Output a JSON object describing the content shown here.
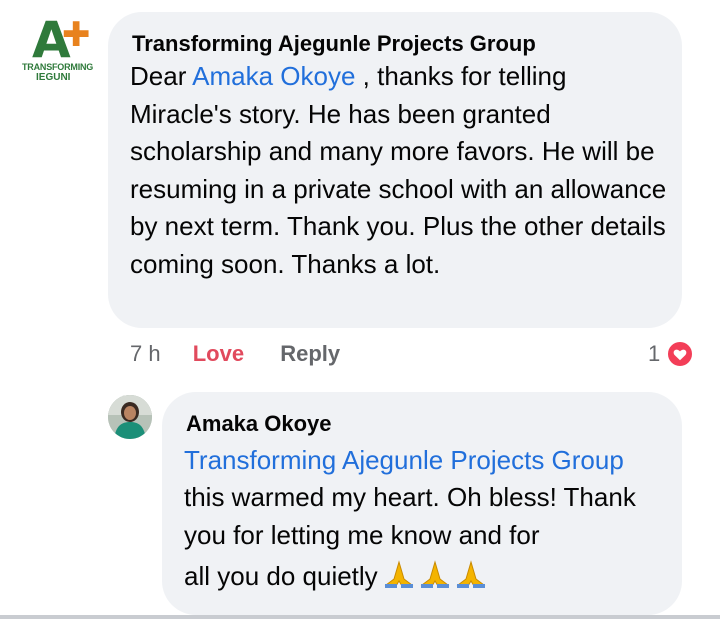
{
  "comment": {
    "logo_letter": "A",
    "logo_line1": "TRANSFORMING",
    "logo_line2": "IEGUNI",
    "author": "Transforming Ajegunle Projects Group",
    "text_before_mention": "Dear ",
    "mention": "Amaka Okoye",
    "text_after_mention": " , thanks for telling Miracle's story. He has been granted scholarship and many more favors. He will be resuming in a private school with an allowance by next term. Thank you. Plus the other details coming soon. Thanks a lot.",
    "time": "7 h",
    "love_label": "Love",
    "reply_label": "Reply",
    "reaction_count": "1",
    "reaction_icon": "heart-icon",
    "reaction_color": "#f33e58"
  },
  "reply": {
    "author": "Amaka Okoye",
    "mention": "Transforming Ajegunle Projects Group",
    "text": "this warmed my heart. Oh bless! Thank you for letting me know and for",
    "text_last_line": "all you do quietly",
    "emoji": "folded-hands-emoji x3"
  },
  "colors": {
    "bubble": "#f0f2f5",
    "mention": "#216fdb",
    "love": "#e14a5d",
    "secondary_text": "#65676b",
    "logo_green": "#2f7a3b",
    "logo_orange": "#e8821e"
  }
}
